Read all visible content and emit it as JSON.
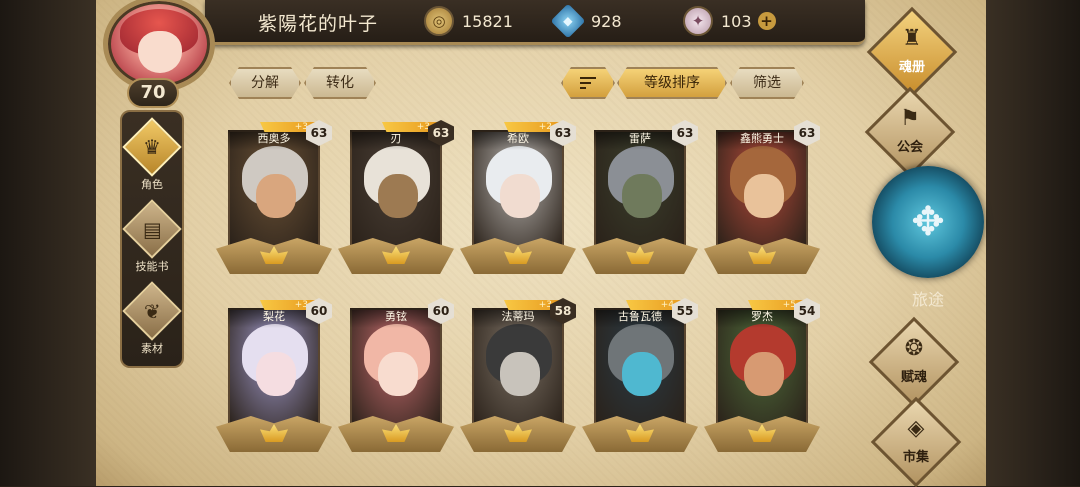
{
  "player": {
    "name": "紫陽花的叶子",
    "level": "70"
  },
  "resources": {
    "gold": "15821",
    "gems": "928",
    "crystals": "103",
    "plus": "+"
  },
  "sidenav": [
    {
      "label": "角色",
      "icon": "helmet-icon"
    },
    {
      "label": "技能书",
      "icon": "book-icon"
    },
    {
      "label": "素材",
      "icon": "material-icon"
    }
  ],
  "filters": {
    "fenjie": "分解",
    "zhuanhua": "转化",
    "sort": "等级排序",
    "filter": "筛选"
  },
  "heroes": [
    {
      "name": "西奥多",
      "level": "63",
      "stars": "+3",
      "hair": "#cfc9c2",
      "skin": "#d9a67e",
      "bg": "#6a5136"
    },
    {
      "name": "刃",
      "level": "63",
      "stars": "+3",
      "hair": "#e8e2d8",
      "skin": "#9d7a52",
      "bg": "#4a3f36"
    },
    {
      "name": "希欧",
      "level": "63",
      "stars": "+2",
      "hair": "#e9ecef",
      "skin": "#f1dcd0",
      "bg": "#b8b4b0"
    },
    {
      "name": "雷萨",
      "level": "63",
      "stars": "",
      "hair": "#8b8f95",
      "skin": "#6f7a5c",
      "bg": "#3a3e2c"
    },
    {
      "name": "鑫熊勇士",
      "level": "63",
      "stars": "",
      "hair": "#a5673c",
      "skin": "#e9c29a",
      "bg": "#b44a3a"
    },
    {
      "name": "梨花",
      "level": "60",
      "stars": "+3",
      "hair": "#e5dff0",
      "skin": "#f5dde1",
      "bg": "#9e98c8"
    },
    {
      "name": "勇铉",
      "level": "60",
      "stars": "",
      "hair": "#f1b7a6",
      "skin": "#f8dccf",
      "bg": "#c26a6c"
    },
    {
      "name": "法蒂玛",
      "level": "58",
      "stars": "+3",
      "hair": "#3a3a3a",
      "skin": "#c8c3bb",
      "bg": "#7a6f63"
    },
    {
      "name": "古鲁瓦德",
      "level": "55",
      "stars": "+4",
      "hair": "#6f7578",
      "skin": "#4fb8d0",
      "bg": "#2a3a44"
    },
    {
      "name": "罗杰",
      "level": "54",
      "stars": "+5",
      "hair": "#b43a2e",
      "skin": "#d79a72",
      "bg": "#4e6a3a"
    }
  ],
  "rightnav": {
    "hunce": "魂册",
    "gonghui": "公会",
    "journey": "旅途",
    "fuhun": "赋魂",
    "shiji": "市集"
  }
}
